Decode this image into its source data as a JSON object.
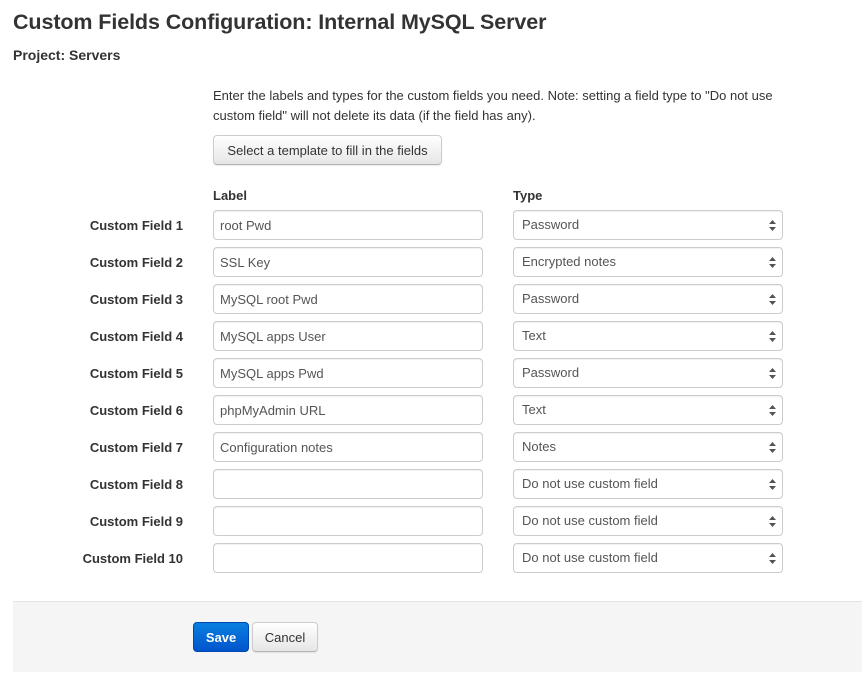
{
  "header": {
    "title": "Custom Fields Configuration: Internal MySQL Server",
    "project": "Project: Servers"
  },
  "intro": {
    "text": "Enter the labels and types for the custom fields you need. Note: setting a field type to \"Do not use custom field\" will not delete its data (if the field has any).",
    "template_button": "Select a template to fill in the fields"
  },
  "columns": {
    "label": "Label",
    "type": "Type"
  },
  "fields": [
    {
      "name": "Custom Field 1",
      "label": "root Pwd",
      "type": "Password"
    },
    {
      "name": "Custom Field 2",
      "label": "SSL Key",
      "type": "Encrypted notes"
    },
    {
      "name": "Custom Field 3",
      "label": "MySQL root Pwd",
      "type": "Password"
    },
    {
      "name": "Custom Field 4",
      "label": "MySQL apps User",
      "type": "Text"
    },
    {
      "name": "Custom Field 5",
      "label": "MySQL apps Pwd",
      "type": "Password"
    },
    {
      "name": "Custom Field 6",
      "label": "phpMyAdmin URL",
      "type": "Text"
    },
    {
      "name": "Custom Field 7",
      "label": "Configuration notes",
      "type": "Notes"
    },
    {
      "name": "Custom Field 8",
      "label": "",
      "type": "Do not use custom field"
    },
    {
      "name": "Custom Field 9",
      "label": "",
      "type": "Do not use custom field"
    },
    {
      "name": "Custom Field 10",
      "label": "",
      "type": "Do not use custom field"
    }
  ],
  "footer": {
    "save": "Save",
    "cancel": "Cancel"
  },
  "colors": {
    "primary": "#0066d6",
    "footer_bg": "#f5f5f5"
  }
}
